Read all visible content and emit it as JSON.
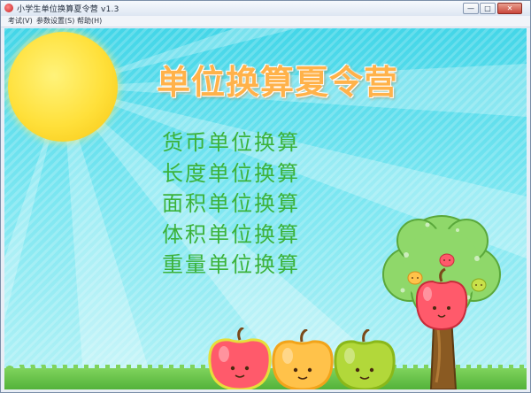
{
  "window": {
    "title": "小学生单位换算夏令营 v1.3",
    "minimize_glyph": "—",
    "maximize_glyph": "□",
    "close_glyph": "✕"
  },
  "menu": {
    "items": [
      {
        "label": "考试(V)"
      },
      {
        "label": "参数设置(S)"
      },
      {
        "label": "帮助(H)"
      }
    ]
  },
  "main": {
    "title": "单位换算夏令营",
    "options": [
      {
        "label": "货币单位换算"
      },
      {
        "label": "长度单位换算"
      },
      {
        "label": "面积单位换算"
      },
      {
        "label": "体积单位换算"
      },
      {
        "label": "重量单位换算"
      }
    ]
  },
  "colors": {
    "sky_top": "#43d6e8",
    "sky_bottom": "#b6f2f6",
    "title_orange": "#ffb24a",
    "option_green": "#3bb23a",
    "sun_yellow": "#ffe03a",
    "apple_red": "#ff5a6b",
    "apple_orange": "#ffc24a",
    "apple_green": "#b2d83a",
    "tree_green": "#8fd86a",
    "trunk_brown": "#8a5a22"
  },
  "icons": {
    "app": "app-apple-icon",
    "sun": "sun-illustration",
    "tree": "apple-tree-illustration"
  }
}
